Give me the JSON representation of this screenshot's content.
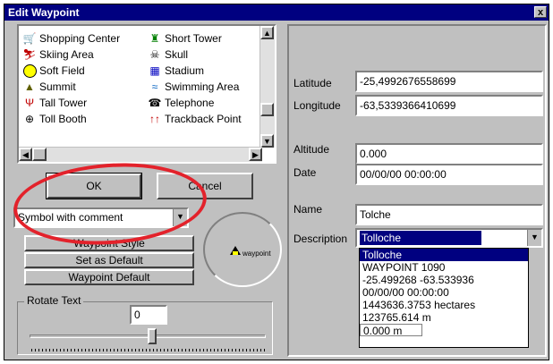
{
  "window": {
    "title": "Edit Waypoint",
    "close_glyph": "x"
  },
  "symbols": [
    {
      "icon": "shopping-cart-icon",
      "label": "Shopping Center"
    },
    {
      "icon": "tower-icon",
      "label": "Short Tower"
    },
    {
      "icon": "skier-icon",
      "label": "Skiing Area"
    },
    {
      "icon": "skull-icon",
      "label": "Skull"
    },
    {
      "icon": "soft-field-icon",
      "label": "Soft Field"
    },
    {
      "icon": "stadium-icon",
      "label": "Stadium"
    },
    {
      "icon": "summit-icon",
      "label": "Summit"
    },
    {
      "icon": "swimmer-icon",
      "label": "Swimming Area"
    },
    {
      "icon": "tall-tower-icon",
      "label": "Tall Tower"
    },
    {
      "icon": "telephone-icon",
      "label": "Telephone"
    },
    {
      "icon": "toll-booth-icon",
      "label": "Toll Booth"
    },
    {
      "icon": "trackback-icon",
      "label": "Trackback Point"
    }
  ],
  "buttons": {
    "ok": "OK",
    "cancel": "Cancel",
    "waypoint_style": "Waypoint Style",
    "set_as_default": "Set as Default",
    "waypoint_default": "Waypoint Default"
  },
  "display_mode": {
    "value": "Symbol with comment"
  },
  "preview": {
    "label": "waypoint"
  },
  "rotate_text": {
    "label": "Rotate Text",
    "value": "0"
  },
  "fields": {
    "latitude": {
      "label": "Latitude",
      "value": "-25,4992676558699"
    },
    "longitude": {
      "label": "Longitude",
      "value": "-63,5339366410699"
    },
    "altitude": {
      "label": "Altitude",
      "value": "0.000"
    },
    "date": {
      "label": "Date",
      "value": "00/00/00 00:00:00"
    },
    "name": {
      "label": "Name",
      "value": "Tolche"
    },
    "description": {
      "label": "Description",
      "value": "Tolloche"
    }
  },
  "description_options": [
    "Tolloche",
    "WAYPOINT  1090",
    "-25.499268   -63.533936",
    "00/00/00 00:00:00",
    "1443636.3753 hectares",
    "123765.614 m",
    "0.000 m"
  ],
  "colors": {
    "titlebar": "#000080",
    "highlight": "#000080",
    "annotation_ring": "#e3222b",
    "dialog": "#c0c0c0"
  }
}
